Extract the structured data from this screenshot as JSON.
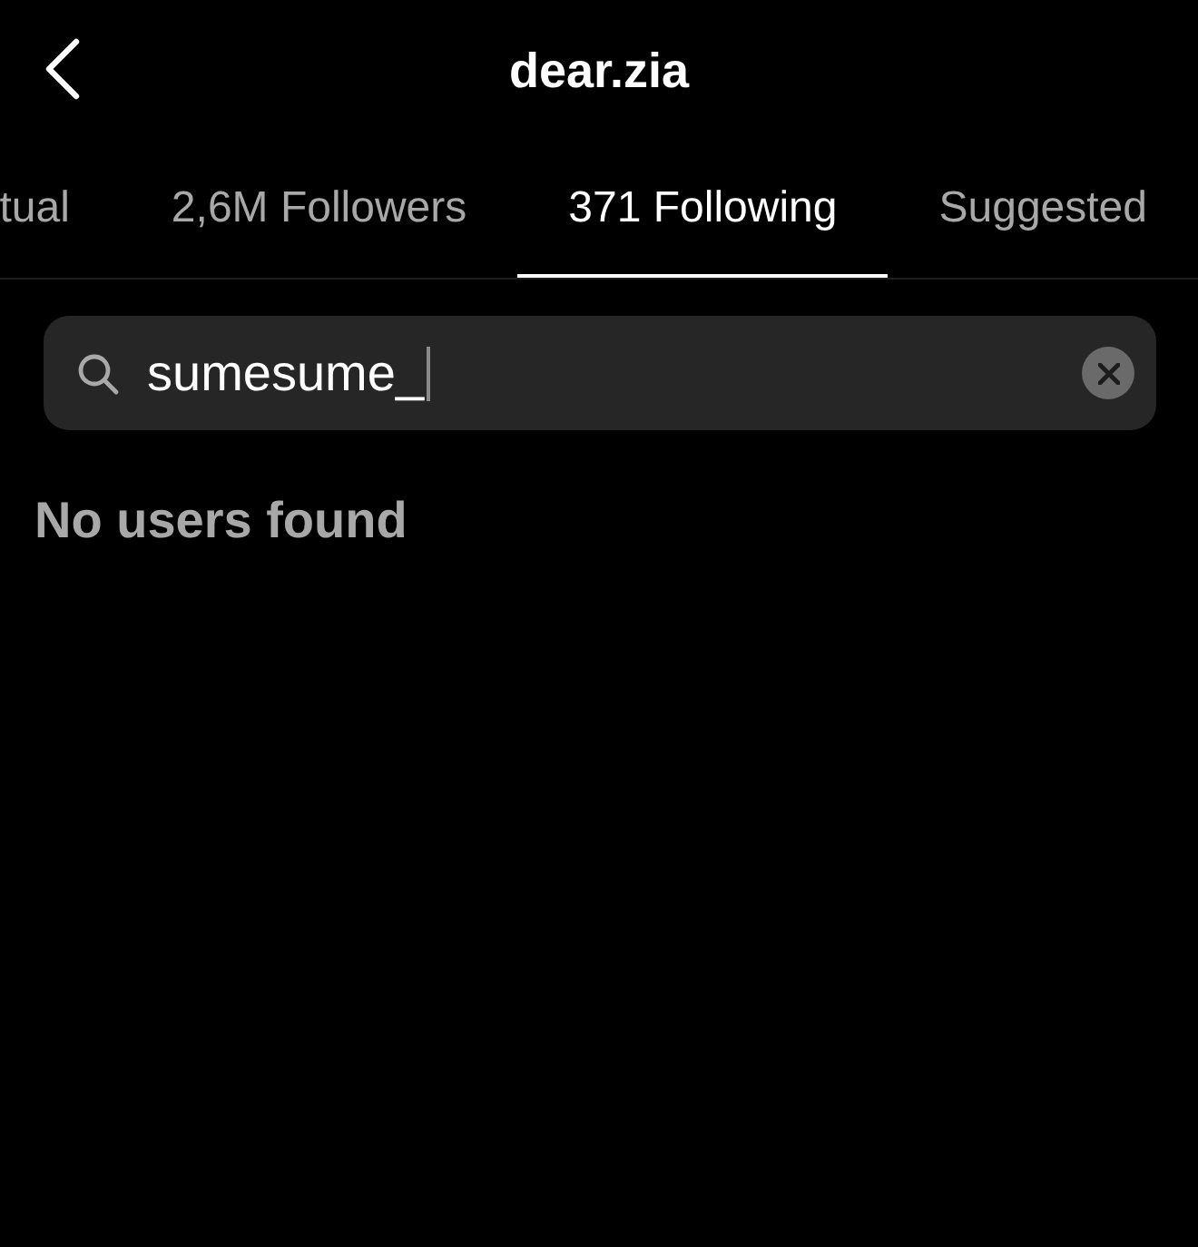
{
  "header": {
    "title": "dear.zia"
  },
  "tabs": [
    {
      "label": "tual",
      "selected": false
    },
    {
      "label": "2,6M Followers",
      "selected": false
    },
    {
      "label": "371 Following",
      "selected": true
    },
    {
      "label": "Suggested",
      "selected": false
    }
  ],
  "search": {
    "value": "sumesume_"
  },
  "empty_message": "No users found"
}
